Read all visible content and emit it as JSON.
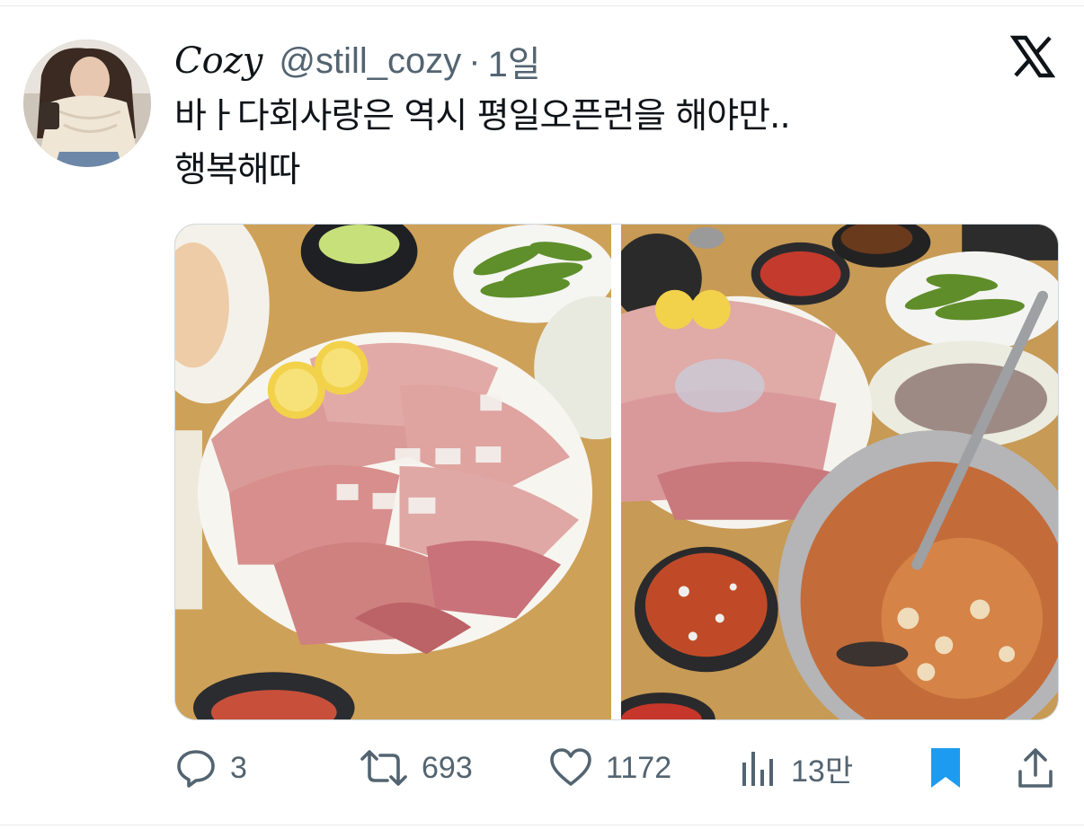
{
  "tweet": {
    "author": {
      "display_name": "Cozy",
      "handle": "@still_cozy",
      "separator": "·",
      "time": "1일",
      "avatar_icon": "profile-photo"
    },
    "platform_icon": "x-logo-icon",
    "text_lines": [
      "바ㅏ다회사랑은 역시 평일오픈런을 해야만..",
      "행복해따"
    ],
    "media": [
      {
        "icon": "sashimi-platter-photo"
      },
      {
        "icon": "sashimi-and-maeuntang-photo"
      }
    ],
    "actions": {
      "reply": {
        "icon": "reply-icon",
        "count": "3"
      },
      "retweet": {
        "icon": "retweet-icon",
        "count": "693"
      },
      "like": {
        "icon": "heart-icon",
        "count": "1172"
      },
      "views": {
        "icon": "views-icon",
        "count": "13만"
      },
      "bookmark": {
        "icon": "bookmark-icon",
        "active": true
      },
      "share": {
        "icon": "share-icon"
      }
    }
  },
  "colors": {
    "text_primary": "#0f1419",
    "text_secondary": "#536471",
    "accent": "#1d9bf0",
    "border": "#cfd9de"
  }
}
